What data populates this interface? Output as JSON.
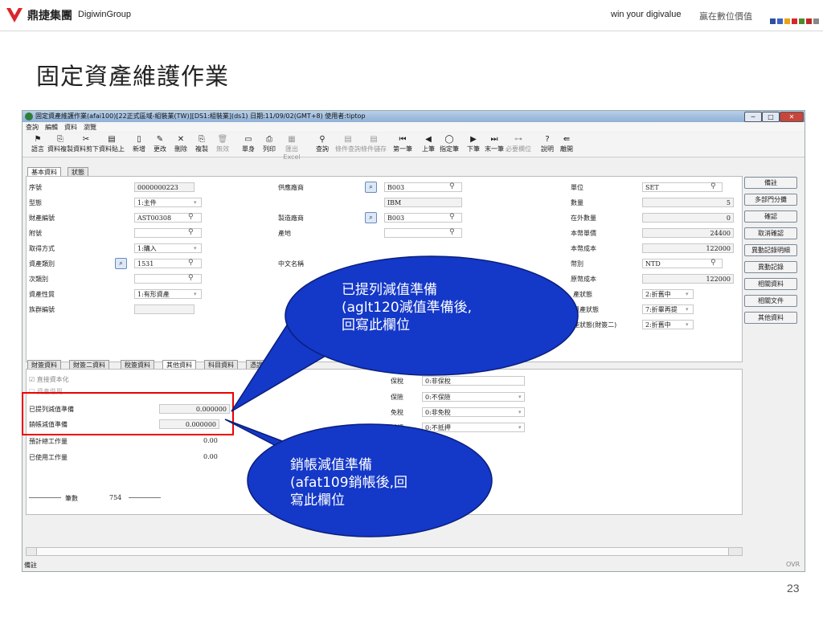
{
  "slide": {
    "brand_cn": "鼎捷集團",
    "brand_en": "DigiwinGroup",
    "slogan_en": "win your digivalue",
    "slogan_cn": "贏在數位價值",
    "title": "固定資產維護作業",
    "page_number": "23",
    "dot_colors": [
      "#2e4f9e",
      "#3d62c2",
      "#e8a317",
      "#d9262c",
      "#4a8c2a",
      "#c02828",
      "#888888"
    ]
  },
  "window": {
    "title": "固定資產維護作業(afai100)[22正式區域-組裝業(TW)][DS1:組裝業](ds1) 日期:11/09/02(GMT+8) 使用者:tiptop",
    "controls": [
      "─",
      "□",
      "✕"
    ]
  },
  "menubar": [
    "查詢",
    "編輯",
    "資料",
    "瀏覽"
  ],
  "toolbar": [
    {
      "icon": "flag-icon",
      "glyph": "⚑",
      "label": "語言",
      "dim": false
    },
    {
      "icon": "copy-icon",
      "glyph": "⎘",
      "label": "資料複製",
      "dim": false
    },
    {
      "icon": "cut-icon",
      "glyph": "✂",
      "label": "資料剪下",
      "dim": false
    },
    {
      "icon": "paste-icon",
      "glyph": "▤",
      "label": "資料貼上",
      "dim": false
    },
    {
      "icon": "new-icon",
      "glyph": "▯",
      "label": "新增",
      "dim": false
    },
    {
      "icon": "edit-icon",
      "glyph": "✎",
      "label": "更改",
      "dim": false
    },
    {
      "icon": "delete-icon",
      "glyph": "✕",
      "label": "刪除",
      "dim": false
    },
    {
      "icon": "duplicate-icon",
      "glyph": "⎘",
      "label": "複製",
      "dim": false
    },
    {
      "icon": "void-icon",
      "glyph": "🗑",
      "label": "無效",
      "dim": true
    },
    {
      "icon": "single-icon",
      "glyph": "▭",
      "label": "單身",
      "dim": false
    },
    {
      "icon": "print-icon",
      "glyph": "⎙",
      "label": "列印",
      "dim": false
    },
    {
      "icon": "excel-icon",
      "glyph": "▦",
      "label": "匯出Excel",
      "dim": true
    },
    {
      "icon": "binoculars-icon",
      "glyph": "⚲",
      "label": "查詢",
      "dim": false
    },
    {
      "icon": "query-cond-icon",
      "glyph": "▤",
      "label": "條件查詢",
      "dim": true
    },
    {
      "icon": "save-cond-icon",
      "glyph": "▤",
      "label": "條件儲存",
      "dim": true
    },
    {
      "icon": "first-icon",
      "glyph": "⏮",
      "label": "第一筆",
      "dim": false
    },
    {
      "icon": "prev-icon",
      "glyph": "◀",
      "label": "上筆",
      "dim": false
    },
    {
      "icon": "goto-icon",
      "glyph": "◯",
      "label": "指定筆",
      "dim": false
    },
    {
      "icon": "next-icon",
      "glyph": "▶",
      "label": "下筆",
      "dim": false
    },
    {
      "icon": "last-icon",
      "glyph": "⏭",
      "label": "末一筆",
      "dim": false
    },
    {
      "icon": "required-icon",
      "glyph": "⊶",
      "label": "必要欄位",
      "dim": true
    },
    {
      "icon": "help-icon",
      "glyph": "?",
      "label": "說明",
      "dim": false
    },
    {
      "icon": "exit-icon",
      "glyph": "⇚",
      "label": "離開",
      "dim": false
    }
  ],
  "tabs_top": [
    "基本資料",
    "狀態"
  ],
  "basic": {
    "seq_label": "序號",
    "seq_value": "0000000223",
    "type_label": "型態",
    "type_value": "1:主件",
    "asset_no_label": "財產編號",
    "asset_no_value": "AST00308",
    "sub_no_label": "附號",
    "sub_no_value": "",
    "acquire_label": "取得方式",
    "acquire_value": "1:購入",
    "category_label": "資產類別",
    "category_value": "1531",
    "subcat_label": "次類別",
    "subcat_value": "",
    "nature_label": "資產性質",
    "nature_value": "1:有形資產",
    "group_label": "族群編號",
    "group_value": "",
    "supplier_label": "供應廠商",
    "supplier_value": "B003",
    "supplier_name": "IBM",
    "maker_label": "製造廠商",
    "maker_value": "B003",
    "origin_label": "產地",
    "origin_value": "",
    "cname_label": "中文名稱",
    "unit_label": "單位",
    "unit_value": "SET",
    "qty_label": "數量",
    "qty_value": "5",
    "outside_label": "在外數量",
    "outside_value": "0",
    "unit_price_label": "本幣單價",
    "unit_price_value": "24400",
    "cost_label": "本幣成本",
    "cost_value": "122000",
    "currency_label": "幣別",
    "currency_value": "NTD",
    "orig_cost_label": "原幣成本",
    "orig_cost_value": "122000",
    "status1_label": "產狀態",
    "status1_value": "2:折舊中",
    "status2_label": "資產狀態",
    "status2_value": "7:折畢再提",
    "status3_label": "產狀態(財簽二)",
    "status3_value": "2:折舊中"
  },
  "right_buttons": [
    "備註",
    "多部門分攤",
    "確認",
    "取消確認",
    "異動記錄明細",
    "異動記錄",
    "相關資料",
    "相關文件",
    "其他資料"
  ],
  "tabs_bottom": [
    "財簽資料",
    "財簽二資料",
    "稅簽資料",
    "其他資料",
    "科目資料",
    "憑證資料"
  ],
  "other": {
    "direct_cap_label": "直接資本化",
    "asset_use_label": "資產借用",
    "impair_label": "已提列減值準備",
    "impair_value": "0.000000",
    "writeoff_label": "銷帳減值準備",
    "writeoff_value": "0.000000",
    "est_work_label": "預計總工作量",
    "est_work_value": "0.00",
    "used_work_label": "已使用工作量",
    "used_work_value": "0.00",
    "insure_label": "保險",
    "insure_value": "0:不保險",
    "taxfree_label": "免稅",
    "taxfree_value": "0:非免稅",
    "mortgage_label": "抵押",
    "mortgage_value": "0:不抵押",
    "cost_label2": "保稅",
    "cost_value2": "0:非保稅"
  },
  "footer": {
    "count_label": "筆數",
    "count_value": "754",
    "status_left": "備註",
    "status_right": "OVR"
  },
  "callouts": {
    "top": [
      "已提列減值準備",
      "(aglt120減值準備後,",
      "回寫此欄位"
    ],
    "bottom": [
      "銷帳減值準備",
      "(afat109銷帳後,回",
      "寫此欄位"
    ]
  },
  "colors": {
    "callout_fill": "#1438c8",
    "callout_stroke": "#0a1e7a",
    "highlight": "#e00000"
  }
}
